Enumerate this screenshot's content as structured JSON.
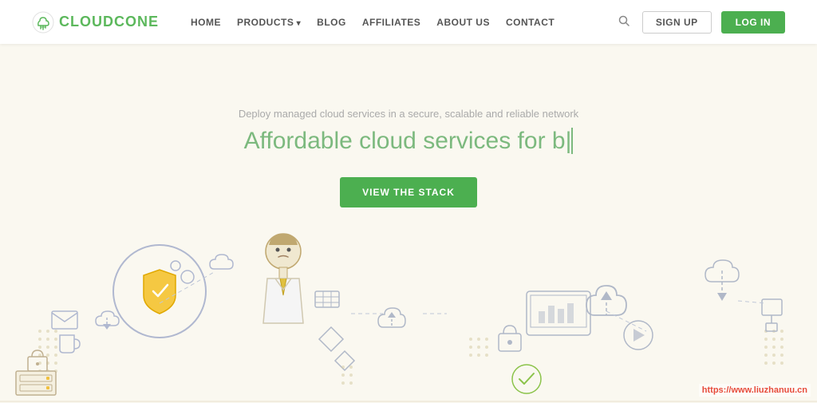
{
  "navbar": {
    "logo_text_part1": "CLOUD",
    "logo_text_part2": "CONE",
    "links": [
      {
        "label": "HOME",
        "has_arrow": false
      },
      {
        "label": "PRODUCTS",
        "has_arrow": true
      },
      {
        "label": "BLOG",
        "has_arrow": false
      },
      {
        "label": "AFFILIATES",
        "has_arrow": false
      },
      {
        "label": "ABOUT US",
        "has_arrow": false
      },
      {
        "label": "CONTACT",
        "has_arrow": false
      }
    ],
    "signup_label": "SIGN UP",
    "login_label": "LOG IN"
  },
  "hero": {
    "subtitle": "Deploy managed cloud services in a secure, scalable and reliable network",
    "title_part1": "Affordable cloud services for b",
    "title_cursor": "|",
    "cta_label": "VIEW THE STACK"
  },
  "watermark": {
    "text": "https://www.liuzhanuu.cn"
  }
}
